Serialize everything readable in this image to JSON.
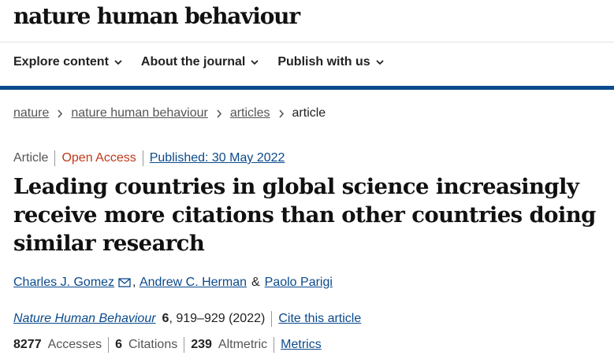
{
  "site": {
    "logo": "nature human behaviour"
  },
  "nav": {
    "items": [
      {
        "label": "Explore content"
      },
      {
        "label": "About the journal"
      },
      {
        "label": "Publish with us"
      }
    ]
  },
  "breadcrumb": {
    "items": [
      "nature",
      "nature human behaviour",
      "articles"
    ],
    "current": "article"
  },
  "article": {
    "type": "Article",
    "access": "Open Access",
    "published": "Published: 30 May 2022",
    "title": "Leading countries in global science increasingly receive more citations than other countries doing similar research",
    "authors": [
      "Charles J. Gomez",
      "Andrew C. Herman",
      "Paolo Parigi"
    ],
    "author_joiner": "&",
    "journal": {
      "name": "Nature Human Behaviour",
      "volume": "6",
      "pages_year": ", 919–929 (2022)",
      "cite_label": "Cite this article"
    },
    "metrics": {
      "accesses_value": "8277",
      "accesses_label": "Accesses",
      "citations_value": "6",
      "citations_label": "Citations",
      "altmetric_value": "239",
      "altmetric_label": "Altmetric",
      "metrics_link": "Metrics"
    }
  },
  "icons": {
    "chevron": "chevron-down-icon",
    "breadcrumb_sep": "chevron-right-icon",
    "mail": "mail-icon"
  },
  "colors": {
    "brand_blue": "#0b4a8c",
    "open_access": "#c0391b",
    "text": "#222222"
  }
}
